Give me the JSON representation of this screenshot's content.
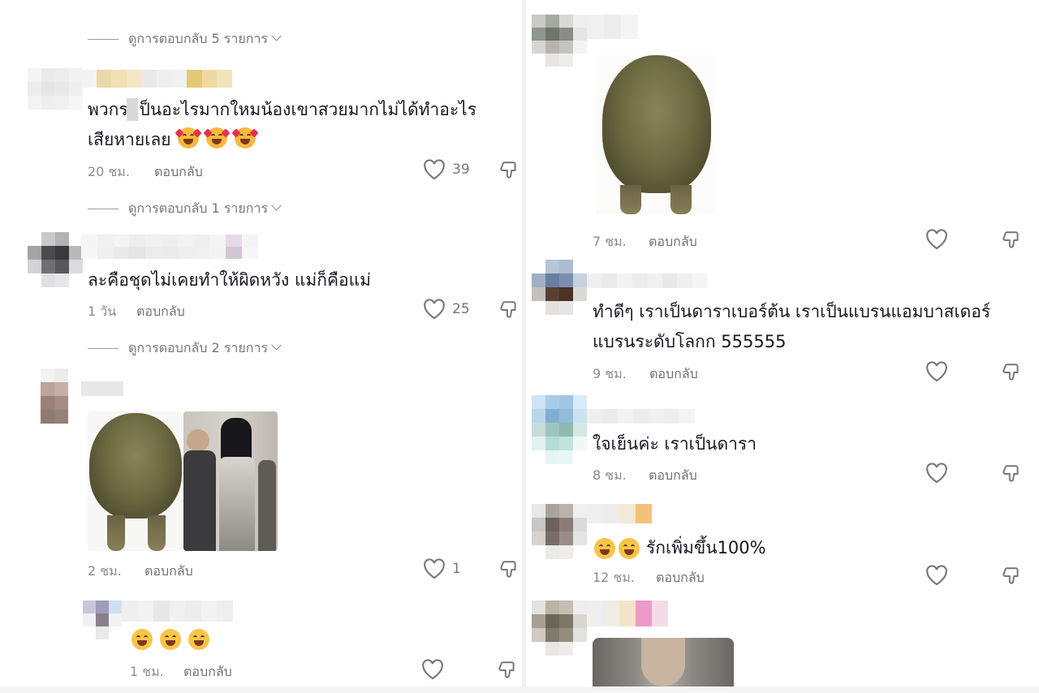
{
  "left": {
    "view_replies_1": "ดูการตอบกลับ 5 รายการ",
    "comment1": {
      "text_line1": "พวกร เป็นอะไรมากใหมน้องเขาสวยมากไม่ได้ทำอะไร",
      "text_line2": "เสียหายเลย",
      "time": "20 ชม.",
      "reply": "ตอบกลับ",
      "likes": "39"
    },
    "view_replies_2": "ดูการตอบกลับ 1 รายการ",
    "comment2": {
      "text": "ละคือชุดไม่เคยทำให้ผิดหวัง แม่ก็คือแม่",
      "time": "1 วัน",
      "reply": "ตอบกลับ",
      "likes": "25"
    },
    "view_replies_3": "ดูการตอบกลับ 2 รายการ",
    "comment3": {
      "time": "2 ชม.",
      "reply": "ตอบกลับ",
      "likes": "1"
    },
    "comment4": {
      "time": "1 ชม.",
      "reply": "ตอบกลับ"
    }
  },
  "right": {
    "comment1": {
      "time": "7 ชม.",
      "reply": "ตอบกลับ"
    },
    "comment2": {
      "text_line1": "ทำดีๆ เราเป็นดาราเบอร์ต้น เราเป็นแบรนแอมบาสเดอร์",
      "text_line2": "แบรนระดับโลกก 555555",
      "time": "9 ชม.",
      "reply": "ตอบกลับ"
    },
    "comment3": {
      "text": "ใจเย็นค่ะ เราเป็นดารา",
      "time": "8 ชม.",
      "reply": "ตอบกลับ"
    },
    "comment4": {
      "text": "รักเพิ่มขึ้น100%",
      "time": "12 ชม.",
      "reply": "ตอบกลับ"
    }
  },
  "icons": {
    "like": "heart-outline-icon",
    "dislike": "thumbs-down-icon",
    "expand": "chevron-down-icon"
  },
  "colors": {
    "text_primary": "#161823",
    "text_secondary": "#8a8b91"
  }
}
